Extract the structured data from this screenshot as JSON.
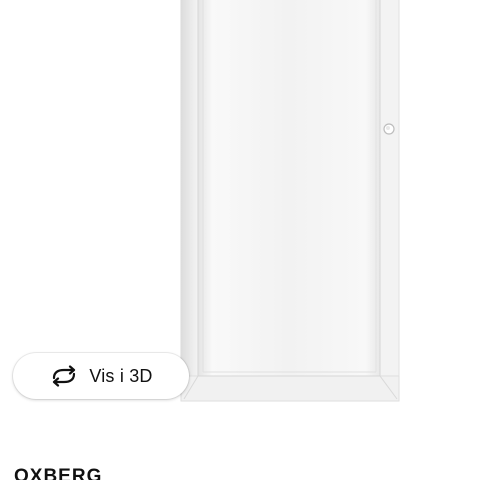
{
  "product": {
    "name": "OXBERG"
  },
  "viewer": {
    "view_3d_label": "Vis i 3D",
    "view_3d_icon": "rotate-3d-icon"
  },
  "colors": {
    "door_frame": "#e6e6e6",
    "glass_panel": "#f3f3f3",
    "text": "#111111"
  }
}
